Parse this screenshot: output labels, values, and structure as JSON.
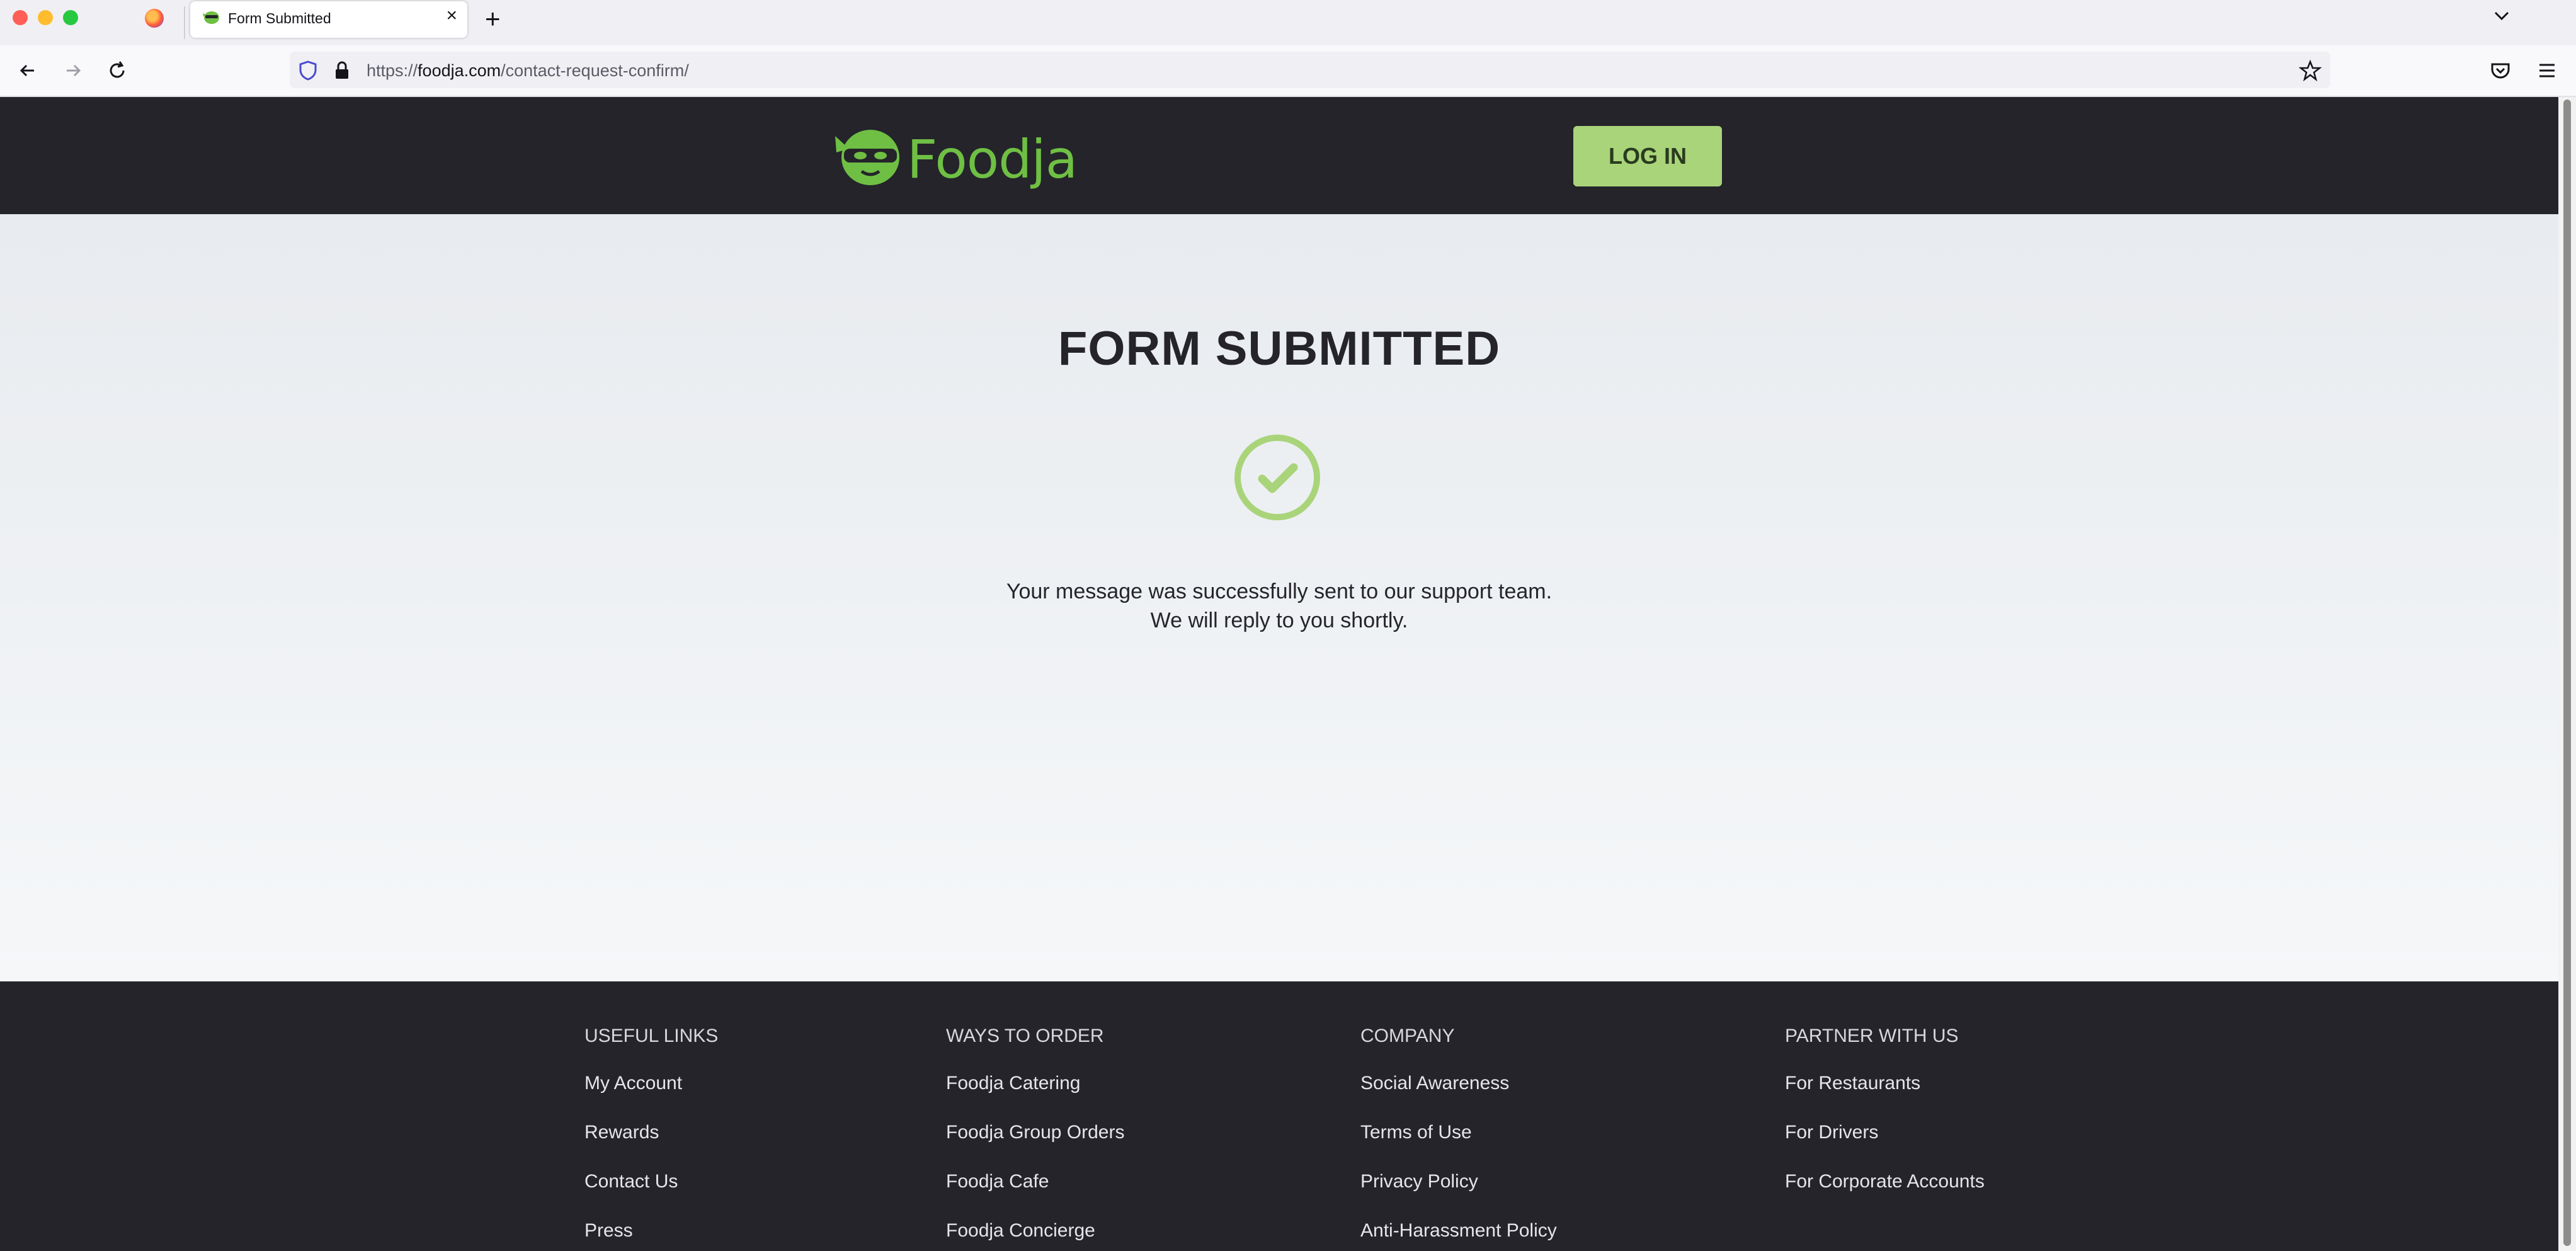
{
  "browser": {
    "tab_title": "Form Submitted",
    "close_glyph": "×",
    "new_tab_glyph": "+",
    "url_prefix": "https://",
    "url_host": "foodja.com",
    "url_path": "/contact-request-confirm/"
  },
  "header": {
    "logo_text": "Foodja",
    "login_label": "LOG IN",
    "brand_color": "#6fbf44",
    "button_color": "#a9d47a"
  },
  "main": {
    "title": "FORM SUBMITTED",
    "message_line1": "Your message was successfully sent to our support team.",
    "message_line2": "We will reply to you shortly.",
    "icon": "check-circle-icon"
  },
  "footer": {
    "columns": [
      {
        "heading": "USEFUL LINKS",
        "links": [
          "My Account",
          "Rewards",
          "Contact Us",
          "Press"
        ]
      },
      {
        "heading": "WAYS TO ORDER",
        "links": [
          "Foodja Catering",
          "Foodja Group Orders",
          "Foodja Cafe",
          "Foodja Concierge"
        ]
      },
      {
        "heading": "COMPANY",
        "links": [
          "Social Awareness",
          "Terms of Use",
          "Privacy Policy",
          "Anti-Harassment Policy"
        ]
      },
      {
        "heading": "PARTNER WITH US",
        "links": [
          "For Restaurants",
          "For Drivers",
          "For Corporate Accounts"
        ]
      }
    ]
  }
}
